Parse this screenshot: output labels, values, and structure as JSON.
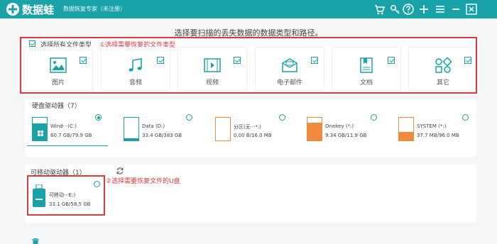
{
  "app": {
    "name": "数据蛙",
    "subtitle": "数据恢复专家（未注册）"
  },
  "colors": {
    "accent": "#1aa2a9",
    "annotation": "#d83b3b",
    "fill": "#f08a3c"
  },
  "titlebar_icons": [
    "cart-icon",
    "key-icon",
    "help-icon",
    "plus-icon",
    "menu-icon",
    "minimize-icon",
    "close-icon"
  ],
  "instruction": "选择要扫描的丢失数据的数据类型和路径。",
  "file_types": {
    "select_all_label": "选择所有文件类型",
    "annotation": "①选择需要恢复的文件类型",
    "items": [
      {
        "label": "图片",
        "icon": "image-icon",
        "checked": true
      },
      {
        "label": "音频",
        "icon": "music-icon",
        "checked": true
      },
      {
        "label": "视频",
        "icon": "video-icon",
        "checked": true
      },
      {
        "label": "电子邮件",
        "icon": "email-icon",
        "checked": true
      },
      {
        "label": "文档",
        "icon": "document-icon",
        "checked": true
      },
      {
        "label": "其它",
        "icon": "other-icon",
        "checked": true
      }
    ]
  },
  "hard_drives": {
    "title": "硬盘驱动器（7）",
    "items": [
      {
        "name": "Wind···(C:)",
        "size": "60.7 GB/79.9 GB",
        "used_fraction": 0.76,
        "selected": true
      },
      {
        "name": "Data (D:)",
        "size": "33.4 GB/383 GB",
        "used_fraction": 0.09,
        "selected": false
      },
      {
        "name": "分区(无···*:)",
        "size": "0.00  B/16.0 MB",
        "used_fraction": 0.0,
        "selected": false
      },
      {
        "name": "Onekey (*:)",
        "size": "9.34 GB/11.9 GB",
        "used_fraction": 0.78,
        "selected": false
      },
      {
        "name": "SYSTEM (*:)",
        "size": "37.7 MB/96.0 MB",
        "used_fraction": 0.39,
        "selected": false
      }
    ]
  },
  "removable_drives": {
    "title": "可移动驱动器（1）",
    "annotation": "②选择需要恢复文件的U盘",
    "items": [
      {
        "name": "可移动···E:)",
        "size": "33.1 GB/58.5 GB",
        "selected": false
      }
    ]
  }
}
